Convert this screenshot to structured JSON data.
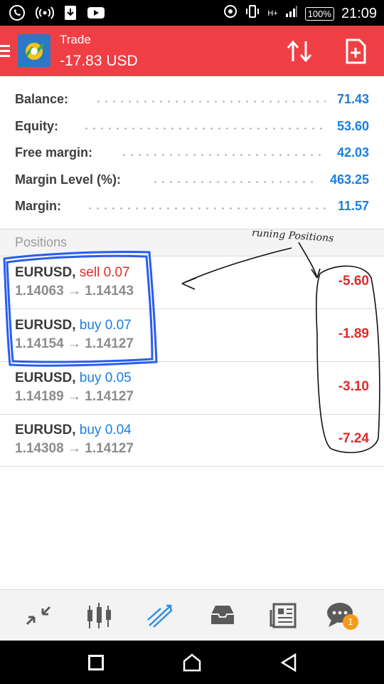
{
  "status_bar": {
    "battery": "100%",
    "time": "21:09",
    "network": "H+"
  },
  "app_bar": {
    "title": "Trade",
    "subtitle": "-17.83 USD",
    "icons": [
      "menu-icon",
      "metatrader-logo",
      "sort-icon",
      "new-order-icon"
    ]
  },
  "account": [
    {
      "label": "Balance:",
      "value": "71.43"
    },
    {
      "label": "Equity:",
      "value": "53.60"
    },
    {
      "label": "Free margin:",
      "value": "42.03"
    },
    {
      "label": "Margin Level (%):",
      "value": "463.25"
    },
    {
      "label": "Margin:",
      "value": "11.57"
    }
  ],
  "positions": {
    "header": "Positions",
    "items": [
      {
        "symbol": "EURUSD,",
        "type": "sell",
        "volume": "0.07",
        "open": "1.14063",
        "arrow": "→",
        "current": "1.14143",
        "profit": "-5.60"
      },
      {
        "symbol": "EURUSD,",
        "type": "buy",
        "volume": "0.07",
        "open": "1.14154",
        "arrow": "→",
        "current": "1.14127",
        "profit": "-1.89"
      },
      {
        "symbol": "EURUSD,",
        "type": "buy",
        "volume": "0.05",
        "open": "1.14189",
        "arrow": "→",
        "current": "1.14127",
        "profit": "-3.10"
      },
      {
        "symbol": "EURUSD,",
        "type": "buy",
        "volume": "0.04",
        "open": "1.14308",
        "arrow": "→",
        "current": "1.14127",
        "profit": "-7.24"
      }
    ]
  },
  "annotation": {
    "text": "runing Positions",
    "color": "#2a5cf0"
  },
  "bottom_nav": {
    "items": [
      "quotes-icon",
      "chart-icon",
      "trade-icon",
      "history-icon",
      "news-icon",
      "chat-icon"
    ],
    "active": "trade-icon",
    "badge": "1"
  },
  "colors": {
    "accent": "#ef3f45",
    "value_blue": "#1a7fe0",
    "loss_red": "#e02a2a"
  }
}
